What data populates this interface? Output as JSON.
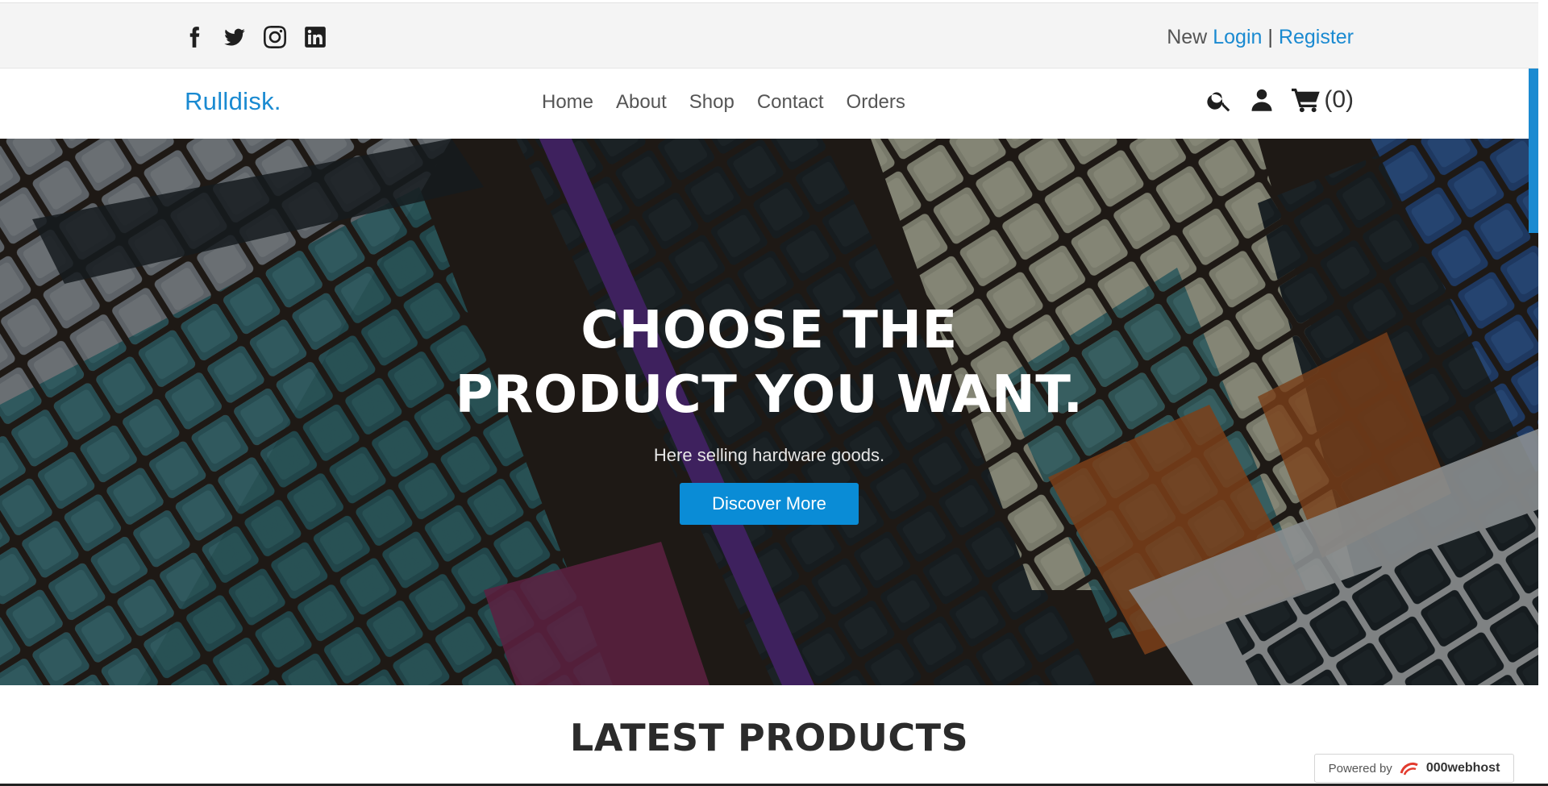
{
  "topbar": {
    "social": [
      {
        "icon": "facebook-icon",
        "label": "Facebook"
      },
      {
        "icon": "twitter-icon",
        "label": "Twitter"
      },
      {
        "icon": "instagram-icon",
        "label": "Instagram"
      },
      {
        "icon": "linkedin-icon",
        "label": "LinkedIn"
      }
    ],
    "auth": {
      "prefix": "New",
      "login": "Login",
      "separator": "|",
      "register": "Register"
    }
  },
  "navbar": {
    "brand": "Rulldisk.",
    "menu": [
      "Home",
      "About",
      "Shop",
      "Contact",
      "Orders"
    ],
    "cart_count": "(0)"
  },
  "hero": {
    "title_line1": "CHOOSE THE",
    "title_line2": "PRODUCT YOU WANT.",
    "subtitle": "Here selling hardware goods.",
    "button": "Discover More"
  },
  "latest": {
    "title": "LATEST PRODUCTS"
  },
  "powered_badge": {
    "prefix": "Powered by",
    "brand": "000webhost"
  },
  "colors": {
    "accent": "#1a8ad1",
    "button": "#0a8cd6",
    "text_dark": "#2b2b2b"
  }
}
